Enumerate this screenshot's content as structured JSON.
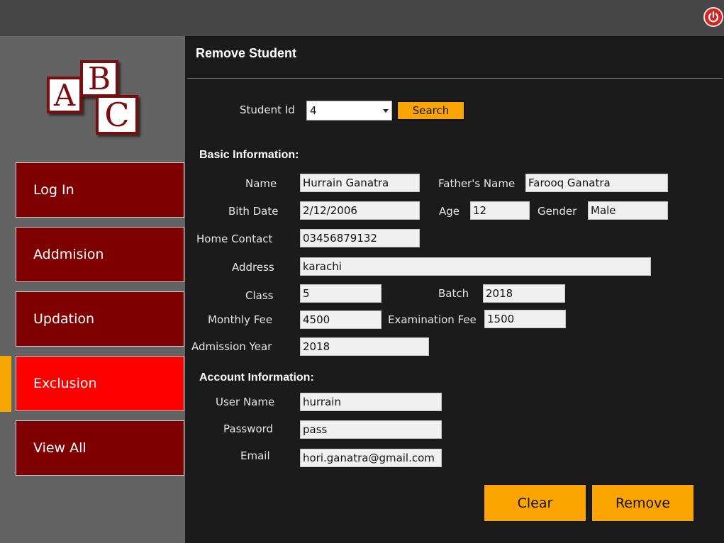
{
  "window": {
    "power_icon": "power-icon",
    "power_color": "#d62222"
  },
  "logo": {
    "letters": [
      "A",
      "B",
      "C"
    ]
  },
  "sidebar": {
    "items": [
      {
        "label": "Log In"
      },
      {
        "label": "Addmision"
      },
      {
        "label": "Updation"
      },
      {
        "label": "Exclusion",
        "active": true
      },
      {
        "label": "View All"
      }
    ],
    "item_color": "#7f0000",
    "active_color": "#fe0000",
    "marker_color": "#f5a600"
  },
  "page": {
    "title": "Remove Student"
  },
  "search": {
    "student_id_label": "Student Id",
    "student_id_value": "4",
    "button_label": "Search"
  },
  "basic": {
    "section_label": "Basic Information:",
    "name_label": "Name",
    "name": "Hurrain Ganatra",
    "father_label": "Father's Name",
    "father": "Farooq Ganatra",
    "birth_label": "Bith Date",
    "birth": "2/12/2006",
    "age_label": "Age",
    "age": "12",
    "gender_label": "Gender",
    "gender": "Male",
    "contact_label": "Home Contact",
    "contact": "03456879132",
    "address_label": "Address",
    "address": "karachi",
    "class_label": "Class",
    "class": "5",
    "batch_label": "Batch",
    "batch": "2018",
    "monthly_fee_label": "Monthly Fee",
    "monthly_fee": "4500",
    "exam_fee_label": "Examination Fee",
    "exam_fee": "1500",
    "admission_year_label": "Admission Year",
    "admission_year": "2018"
  },
  "account": {
    "section_label": "Account Information:",
    "username_label": "User Name",
    "username": "hurrain",
    "password_label": "Password",
    "password": "pass",
    "email_label": "Email",
    "email": "hori.ganatra@gmail.com"
  },
  "actions": {
    "clear_label": "Clear",
    "remove_label": "Remove",
    "button_color": "#fba400"
  }
}
